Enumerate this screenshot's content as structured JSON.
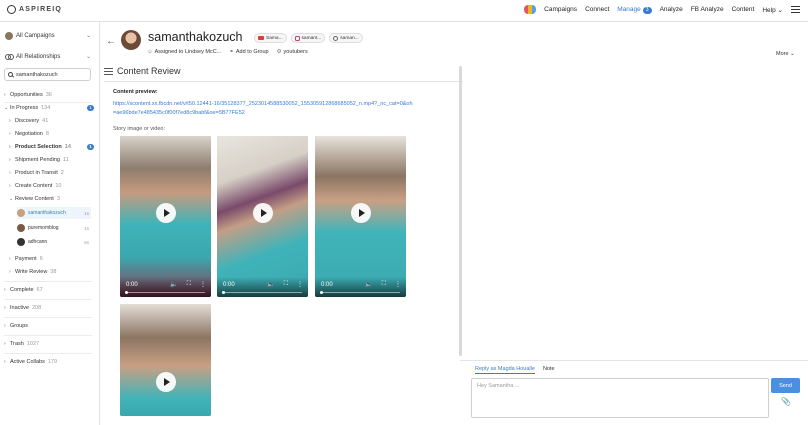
{
  "topbar": {
    "logo_text": "ASPIREIQ",
    "nav": [
      "Campaigns",
      "Connect",
      "Manage",
      "Analyze",
      "FB Analyze",
      "Content",
      "Help"
    ],
    "manage_badge": "3",
    "help_chevron": "⌄"
  },
  "sidebar": {
    "campaign_dropdown": "All Campaigns",
    "relationship_dropdown": "All Relationships",
    "search_value": "samanthakozuch",
    "tree": [
      {
        "label": "Opportunities",
        "count": "36"
      },
      {
        "label": "In Progress",
        "count": "134",
        "badge": "1"
      },
      {
        "label": "Discovery",
        "count": "41"
      },
      {
        "label": "Negotiation",
        "count": "8"
      },
      {
        "label": "Product Selection",
        "count": "14",
        "badge": "1"
      },
      {
        "label": "Shipment Pending",
        "count": "11"
      },
      {
        "label": "Product in Transit",
        "count": "2"
      },
      {
        "label": "Create Content",
        "count": "10"
      },
      {
        "label": "Review Content",
        "count": "3"
      },
      {
        "label": "Payment",
        "count": "6"
      },
      {
        "label": "Write Review",
        "count": "38"
      },
      {
        "label": "Complete",
        "count": "67"
      },
      {
        "label": "Inactive",
        "count": "208"
      },
      {
        "label": "Groups",
        "count": ""
      },
      {
        "label": "Trash",
        "count": "1027"
      },
      {
        "label": "Active Collabs",
        "count": "179"
      }
    ],
    "review_people": [
      {
        "name": "samanthakozuch",
        "time": "1s"
      },
      {
        "name": "puremomblog",
        "time": "1s"
      },
      {
        "name": "adhcann",
        "time": "6s"
      }
    ]
  },
  "header": {
    "username": "samanthakozuch",
    "chips": [
      "Sama...",
      "samant...",
      "saman..."
    ],
    "assigned": "Assigned to Lindsey McC...",
    "add_group": "Add to Group",
    "group": "youtubers",
    "more": "More"
  },
  "content_review": {
    "title": "Content Review",
    "preview_label": "Content preview:",
    "url": "https://scontent.xx.fbcdn.net/v/t50.12441-16/35128377_2523014588530052_1553059128686850​52_n.mp4?_nc_cat=0&oh=ae96bde7e485435c0f00f7ed8c9babf&oe=5B77FE52",
    "story_label": "Story image or video:",
    "video_time": "0:00"
  },
  "reply": {
    "tab_reply": "Reply as Magda Houalle",
    "tab_note": "Note",
    "placeholder": "Hey Samantha ...",
    "send_label": "Send"
  }
}
